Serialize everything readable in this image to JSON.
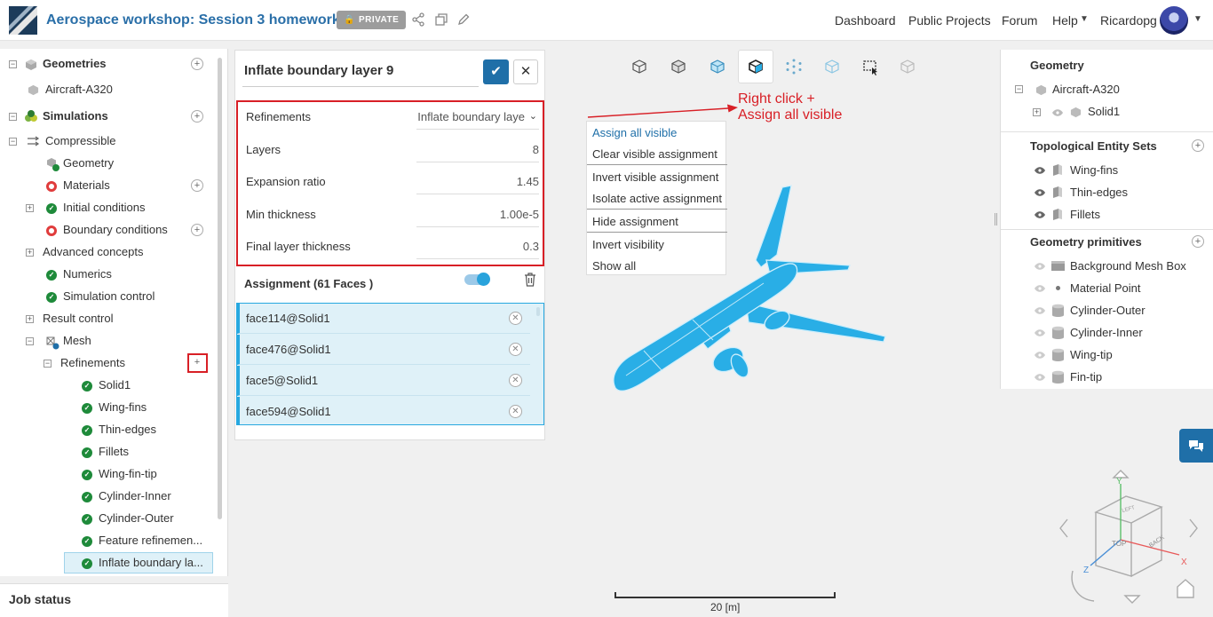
{
  "header": {
    "project_title": "Aerospace workshop: Session 3 homework",
    "private_badge": "PRIVATE",
    "nav": [
      "Dashboard",
      "Public Projects",
      "Forum",
      "Help"
    ],
    "username": "Ricardopg"
  },
  "left_tree": {
    "geometries_label": "Geometries",
    "geometry_item": "Aircraft-A320",
    "simulations_label": "Simulations",
    "items": [
      {
        "label": "Compressible"
      },
      {
        "label": "Geometry"
      },
      {
        "label": "Materials"
      },
      {
        "label": "Initial conditions"
      },
      {
        "label": "Boundary conditions"
      },
      {
        "label": "Advanced concepts"
      },
      {
        "label": "Numerics"
      },
      {
        "label": "Simulation control"
      },
      {
        "label": "Result control"
      },
      {
        "label": "Mesh"
      },
      {
        "label": "Refinements"
      },
      {
        "label": "Solid1"
      },
      {
        "label": "Wing-fins"
      },
      {
        "label": "Thin-edges"
      },
      {
        "label": "Fillets"
      },
      {
        "label": "Wing-fin-tip"
      },
      {
        "label": "Cylinder-Inner"
      },
      {
        "label": "Cylinder-Outer"
      },
      {
        "label": "Feature refinemen..."
      },
      {
        "label": "Inflate boundary la..."
      }
    ],
    "job_status": "Job status"
  },
  "editor": {
    "title": "Inflate boundary layer 9",
    "fields": [
      {
        "label": "Refinements",
        "value": "Inflate boundary laye"
      },
      {
        "label": "Layers",
        "value": "8"
      },
      {
        "label": "Expansion ratio",
        "value": "1.45"
      },
      {
        "label": "Min thickness",
        "value": "1.00e-5"
      },
      {
        "label": "Final layer thickness",
        "value": "0.3"
      }
    ],
    "assignment_title": "Assignment (61 Faces )",
    "faces": [
      "face114@Solid1",
      "face476@Solid1",
      "face5@Solid1",
      "face594@Solid1"
    ]
  },
  "context_menu": {
    "items": [
      "Assign all visible",
      "Clear visible assignment",
      "Invert visible assignment",
      "Isolate active assignment",
      "Hide assignment",
      "Invert visibility",
      "Show all"
    ]
  },
  "annotation": {
    "line1": "Right click +",
    "line2": "Assign all visible"
  },
  "right_panel": {
    "geometry_head": "Geometry",
    "geometry_root": "Aircraft-A320",
    "geometry_child": "Solid1",
    "topo_head": "Topological Entity Sets",
    "topo_items": [
      "Wing-fins",
      "Thin-edges",
      "Fillets"
    ],
    "prim_head": "Geometry primitives",
    "prim_items": [
      "Background Mesh Box",
      "Material Point",
      "Cylinder-Outer",
      "Cylinder-Inner",
      "Wing-tip",
      "Fin-tip"
    ]
  },
  "viewport": {
    "scale_label": "20 [m]",
    "cube_faces": {
      "top": "TOP",
      "back": "BACK",
      "left": "LEFT"
    },
    "axes": {
      "x": "X",
      "y": "Y",
      "z": "Z"
    }
  },
  "colors": {
    "accent": "#1f6fa8",
    "aircraft": "#29aee6",
    "highlight": "#d81f26",
    "selected_bg": "#dff1f8"
  }
}
